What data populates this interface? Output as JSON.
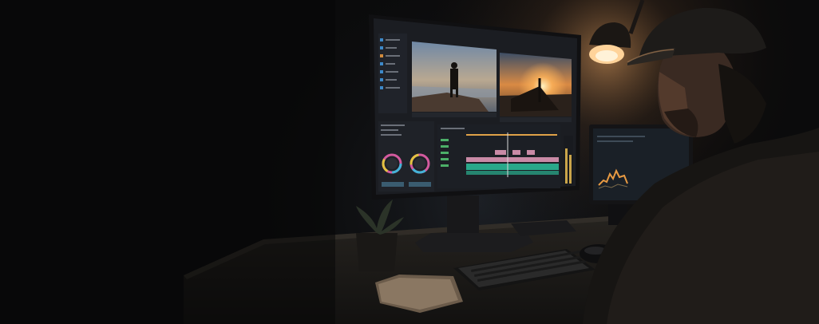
{
  "scene": {
    "description_name": "video-editing-desk-night",
    "colors": {
      "background": "#0b0b0c",
      "desk": "#1c1a18",
      "monitor_bezel": "#141416",
      "screen_bg": "#1b1d22",
      "timeline_green": "#2aa88a",
      "timeline_pink": "#c98aa6",
      "lamp_glow": "#ffb36b",
      "sunset_orange": "#e88a3a"
    },
    "icons": [
      "color-wheel-icon",
      "desk-lamp-icon",
      "potted-plant-icon",
      "keyboard-icon",
      "mouse-icon"
    ]
  }
}
